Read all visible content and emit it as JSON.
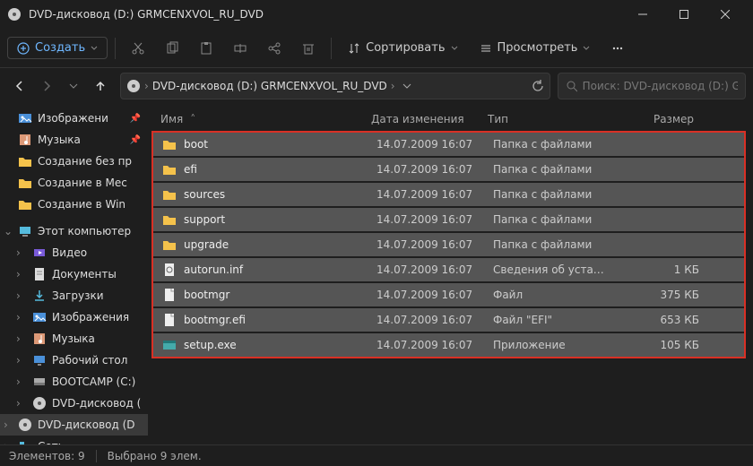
{
  "title": "DVD-дисковод (D:) GRMCENXVOL_RU_DVD",
  "toolbar": {
    "create": "Создать",
    "sort": "Сортировать",
    "view": "Просмотреть"
  },
  "breadcrumb": {
    "seg1": "DVD-дисковод (D:) GRMCENXVOL_RU_DVD"
  },
  "search": {
    "placeholder": "Поиск: DVD-дисковод (D:) GRMCENXVOL_RU_"
  },
  "sidebar": {
    "items": [
      {
        "label": "Изображени",
        "pinned": true,
        "icon": "image"
      },
      {
        "label": "Музыка",
        "pinned": true,
        "icon": "music"
      },
      {
        "label": "Создание без пр",
        "icon": "folder"
      },
      {
        "label": "Создание в Мес",
        "icon": "folder"
      },
      {
        "label": "Создание в Win",
        "icon": "folder"
      }
    ],
    "pc_label": "Этот компьютер",
    "pc": [
      {
        "label": "Видео",
        "icon": "video"
      },
      {
        "label": "Документы",
        "icon": "doc"
      },
      {
        "label": "Загрузки",
        "icon": "download"
      },
      {
        "label": "Изображения",
        "icon": "image"
      },
      {
        "label": "Музыка",
        "icon": "music"
      },
      {
        "label": "Рабочий стол",
        "icon": "desktop"
      },
      {
        "label": "BOOTCAMP (C:)",
        "icon": "disk"
      },
      {
        "label": "DVD-дисковод (",
        "icon": "dvd"
      }
    ],
    "dvd_sel": "DVD-дисковод (D",
    "network": "Сеть"
  },
  "columns": {
    "name": "Имя",
    "date": "Дата изменения",
    "type": "Тип",
    "size": "Размер"
  },
  "files": [
    {
      "name": "boot",
      "date": "14.07.2009 16:07",
      "type": "Папка с файлами",
      "size": "",
      "icon": "folder"
    },
    {
      "name": "efi",
      "date": "14.07.2009 16:07",
      "type": "Папка с файлами",
      "size": "",
      "icon": "folder"
    },
    {
      "name": "sources",
      "date": "14.07.2009 16:07",
      "type": "Папка с файлами",
      "size": "",
      "icon": "folder"
    },
    {
      "name": "support",
      "date": "14.07.2009 16:07",
      "type": "Папка с файлами",
      "size": "",
      "icon": "folder"
    },
    {
      "name": "upgrade",
      "date": "14.07.2009 16:07",
      "type": "Папка с файлами",
      "size": "",
      "icon": "folder"
    },
    {
      "name": "autorun.inf",
      "date": "14.07.2009 16:07",
      "type": "Сведения об устано…",
      "size": "1 КБ",
      "icon": "gear"
    },
    {
      "name": "bootmgr",
      "date": "14.07.2009 16:07",
      "type": "Файл",
      "size": "375 КБ",
      "icon": "file"
    },
    {
      "name": "bootmgr.efi",
      "date": "14.07.2009 16:07",
      "type": "Файл \"EFI\"",
      "size": "653 КБ",
      "icon": "file"
    },
    {
      "name": "setup.exe",
      "date": "14.07.2009 16:07",
      "type": "Приложение",
      "size": "105 КБ",
      "icon": "app"
    }
  ],
  "status": {
    "count": "Элементов: 9",
    "selected": "Выбрано 9 элем."
  }
}
